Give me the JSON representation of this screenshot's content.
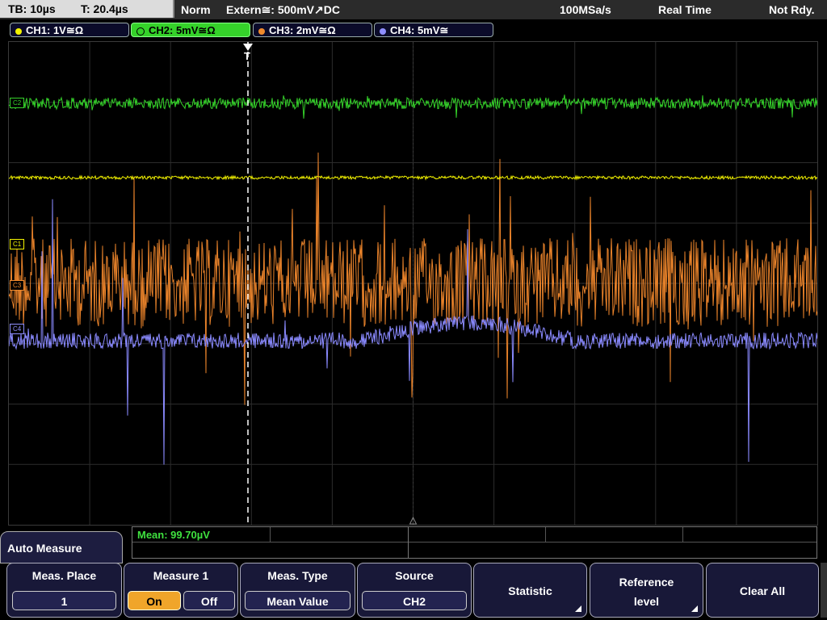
{
  "status": {
    "timebase": "TB: 10µs",
    "trigger_time": "T: 20.4µs",
    "mode": "Norm",
    "trigger_source": "Extern≅: 500mV↗DC",
    "sample_rate": "100MSa/s",
    "acquisition": "Real Time",
    "state": "Not Rdy."
  },
  "channels": [
    {
      "label": "CH1: 1V≅Ω",
      "color": "#f3f300"
    },
    {
      "label": "CH2: 5mV≅Ω",
      "color": "#35d22a"
    },
    {
      "label": "CH3: 2mV≅Ω",
      "color": "#f08a2c"
    },
    {
      "label": "CH4: 5mV≅",
      "color": "#8f8fff"
    }
  ],
  "markers": {
    "c2": "C2",
    "c1": "C1",
    "c3": "C3",
    "c4": "C4",
    "trigger": "T"
  },
  "measurement": {
    "mean": "Mean: 99.70µV"
  },
  "menu": {
    "title": "Auto Measure",
    "meas_place": {
      "label": "Meas. Place",
      "value": "1"
    },
    "measure1": {
      "label": "Measure 1",
      "on": "On",
      "off": "Off"
    },
    "meas_type": {
      "label": "Meas. Type",
      "value": "Mean Value"
    },
    "source": {
      "label": "Source",
      "value": "CH2"
    },
    "statistic": "Statistic",
    "reference_level_1": "Reference",
    "reference_level_2": "level",
    "clear_all": "Clear All"
  }
}
